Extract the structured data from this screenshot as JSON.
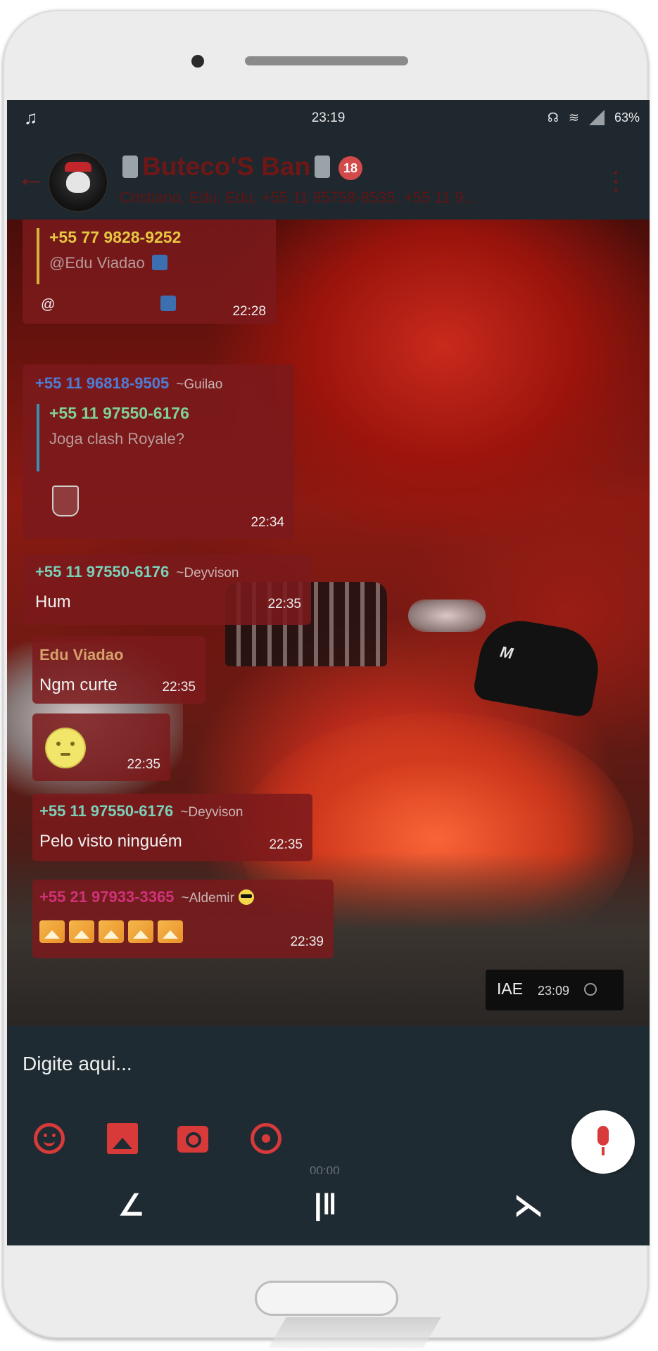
{
  "status_bar": {
    "time": "23:19",
    "battery": "63%",
    "left_icon": "music-note-icon",
    "right_icons": [
      "headphones-icon",
      "wifi-icon",
      "signal-icon"
    ]
  },
  "toolbar": {
    "back_icon": "back-arrow-icon",
    "group_name": "Buteco'S Ban",
    "age_badge": "18",
    "members": "Cristiano, Edu, Edu, +55 11 95758-8535, +55 11 9..."
  },
  "messages": [
    {
      "quote_name": "+55 77 9828-9252",
      "quote_text": "@Edu Viadao",
      "text": "@",
      "time": "22:28"
    },
    {
      "sender": "+55 11 96818-9505",
      "alias": "~Guilao",
      "quote_name": "+55 11 97550-6176",
      "quote_text": "Joga clash Royale?",
      "time": "22:34"
    },
    {
      "sender": "+55 11 97550-6176",
      "alias": "~Deyvison",
      "text": "Hum",
      "time": "22:35"
    },
    {
      "sender": "Edu Viadao",
      "text": "Ngm curte",
      "time": "22:35"
    },
    {
      "emoji": "sad-face-emoji",
      "time": "22:35"
    },
    {
      "sender": "+55 11 97550-6176",
      "alias": "~Deyvison",
      "text": "Pelo visto ninguém",
      "time": "22:35"
    },
    {
      "sender": "+55 21 97933-3365",
      "alias": "~Aldemir",
      "time": "22:39"
    }
  ],
  "outgoing": {
    "text": "IAE",
    "time": "23:09"
  },
  "input": {
    "placeholder": "Digite aqui...",
    "timer": "00:00"
  },
  "colors": {
    "accent": "#d83a3a",
    "bubble": "#7c1a1c",
    "toolbar_bg": "#1e282e"
  }
}
